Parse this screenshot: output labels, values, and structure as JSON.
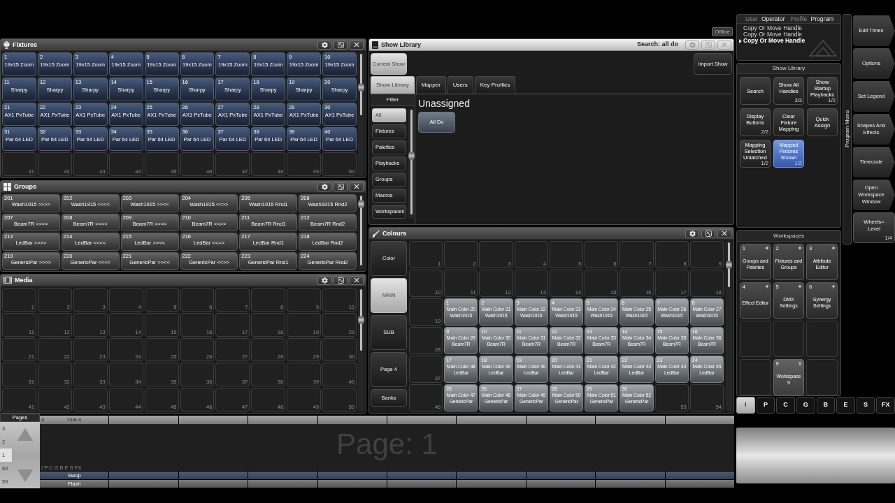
{
  "top_bar": {
    "status": "Offline"
  },
  "fixtures": {
    "title": "Fixtures",
    "active": false,
    "cells": [
      {
        "kind": "fixture",
        "number": "1",
        "label": "19x15 Zoom"
      },
      {
        "kind": "fixture",
        "number": "2",
        "label": "19x15 Zoom"
      },
      {
        "kind": "fixture",
        "number": "3",
        "label": "19x15 Zoom"
      },
      {
        "kind": "fixture",
        "number": "4",
        "label": "19x15 Zoom"
      },
      {
        "kind": "fixture",
        "number": "5",
        "label": "19x15 Zoom"
      },
      {
        "kind": "fixture",
        "number": "6",
        "label": "19x15 Zoom"
      },
      {
        "kind": "fixture",
        "number": "7",
        "label": "19x15 Zoom"
      },
      {
        "kind": "fixture",
        "number": "8",
        "label": "19x15 Zoom"
      },
      {
        "kind": "fixture",
        "number": "9",
        "label": "19x15 Zoom"
      },
      {
        "kind": "fixture",
        "number": "10",
        "label": "19x15 Zoom"
      },
      {
        "kind": "fixture",
        "number": "11",
        "label": "Sharpy"
      },
      {
        "kind": "fixture",
        "number": "12",
        "label": "Sharpy"
      },
      {
        "kind": "fixture",
        "number": "13",
        "label": "Sharpy"
      },
      {
        "kind": "fixture",
        "number": "14",
        "label": "Sharpy"
      },
      {
        "kind": "fixture",
        "number": "15",
        "label": "Sharpy"
      },
      {
        "kind": "fixture",
        "number": "16",
        "label": "Sharpy"
      },
      {
        "kind": "fixture",
        "number": "17",
        "label": "Sharpy"
      },
      {
        "kind": "fixture",
        "number": "18",
        "label": "Sharpy"
      },
      {
        "kind": "fixture",
        "number": "19",
        "label": "Sharpy"
      },
      {
        "kind": "fixture",
        "number": "20",
        "label": "Sharpy"
      },
      {
        "kind": "fixture",
        "number": "21",
        "label": "AX1 PxTube"
      },
      {
        "kind": "fixture",
        "number": "22",
        "label": "AX1 PxTube"
      },
      {
        "kind": "fixture",
        "number": "23",
        "label": "AX1 PxTube"
      },
      {
        "kind": "fixture",
        "number": "24",
        "label": "AX1 PxTube"
      },
      {
        "kind": "fixture",
        "number": "25",
        "label": "AX1 PxTube"
      },
      {
        "kind": "fixture",
        "number": "26",
        "label": "AX1 PxTube"
      },
      {
        "kind": "fixture",
        "number": "27",
        "label": "AX1 PxTube"
      },
      {
        "kind": "fixture",
        "number": "28",
        "label": "AX1 PxTube"
      },
      {
        "kind": "fixture",
        "number": "29",
        "label": "AX1 PxTube"
      },
      {
        "kind": "fixture",
        "number": "30",
        "label": "AX1 PxTube"
      },
      {
        "kind": "fixture",
        "number": "31",
        "label": "Par 64 LED"
      },
      {
        "kind": "fixture",
        "number": "32",
        "label": "Par 64 LED"
      },
      {
        "kind": "fixture",
        "number": "33",
        "label": "Par 64 LED"
      },
      {
        "kind": "fixture",
        "number": "34",
        "label": "Par 64 LED"
      },
      {
        "kind": "fixture",
        "number": "35",
        "label": "Par 64 LED"
      },
      {
        "kind": "fixture",
        "number": "36",
        "label": "Par 64 LED"
      },
      {
        "kind": "fixture",
        "number": "37",
        "label": "Par 64 LED"
      },
      {
        "kind": "fixture",
        "number": "38",
        "label": "Par 64 LED"
      },
      {
        "kind": "fixture",
        "number": "39",
        "label": "Par 64 LED"
      },
      {
        "kind": "fixture",
        "number": "40",
        "label": "Par 64 LED"
      },
      {
        "kind": "empty",
        "number": "41"
      },
      {
        "kind": "empty",
        "number": "42"
      },
      {
        "kind": "empty",
        "number": "43"
      },
      {
        "kind": "empty",
        "number": "44"
      },
      {
        "kind": "empty",
        "number": "45"
      },
      {
        "kind": "empty",
        "number": "46"
      },
      {
        "kind": "empty",
        "number": "47"
      },
      {
        "kind": "empty",
        "number": "48"
      },
      {
        "kind": "empty",
        "number": "49"
      },
      {
        "kind": "empty",
        "number": "50"
      }
    ]
  },
  "groups": {
    "title": "Groups",
    "active": false,
    "cells": [
      {
        "kind": "group",
        "number": "201",
        "label": "Wash1915 >>>>"
      },
      {
        "kind": "group",
        "number": "202",
        "label": "Wash1915 <<<<"
      },
      {
        "kind": "group",
        "number": "203",
        "label": "Wash1915 >><<"
      },
      {
        "kind": "group",
        "number": "204",
        "label": "Wash1915 <<>>"
      },
      {
        "kind": "group",
        "number": "205",
        "label": "Wash1915 Rnd1"
      },
      {
        "kind": "group",
        "number": "206",
        "label": "Wash1915 Rnd2"
      },
      {
        "kind": "group",
        "number": "207",
        "label": "Beam7R >>>>"
      },
      {
        "kind": "group",
        "number": "208",
        "label": "Beam7R <<<<"
      },
      {
        "kind": "group",
        "number": "209",
        "label": "Beam7R >><<"
      },
      {
        "kind": "group",
        "number": "210",
        "label": "Beam7R <<>>"
      },
      {
        "kind": "group",
        "number": "211",
        "label": "Beam7R Rnd1"
      },
      {
        "kind": "group",
        "number": "212",
        "label": "Beam7R Rnd2"
      },
      {
        "kind": "group",
        "number": "213",
        "label": "LedBar >>>>"
      },
      {
        "kind": "group",
        "number": "214",
        "label": "LedBar <<<<"
      },
      {
        "kind": "group",
        "number": "215",
        "label": "LedBar >><<"
      },
      {
        "kind": "group",
        "number": "216",
        "label": "LedBar <<>>"
      },
      {
        "kind": "group",
        "number": "217",
        "label": "LedBar Rnd1"
      },
      {
        "kind": "group",
        "number": "218",
        "label": "LedBar Rnd2"
      },
      {
        "kind": "group",
        "number": "219",
        "label": "GenericPar >>>>"
      },
      {
        "kind": "group",
        "number": "220",
        "label": "GenericPar <<<<"
      },
      {
        "kind": "group",
        "number": "221",
        "label": "GenericPar >><<"
      },
      {
        "kind": "group",
        "number": "222",
        "label": "GenericPar <<>>"
      },
      {
        "kind": "group",
        "number": "223",
        "label": "GenericPar Rnd1"
      },
      {
        "kind": "group",
        "number": "224",
        "label": "GenericPar Rnd2"
      }
    ]
  },
  "media": {
    "title": "Media",
    "active": false,
    "cells": [
      {
        "kind": "empty",
        "number": "1"
      },
      {
        "kind": "empty",
        "number": "2"
      },
      {
        "kind": "empty",
        "number": "3"
      },
      {
        "kind": "empty",
        "number": "4"
      },
      {
        "kind": "empty",
        "number": "5"
      },
      {
        "kind": "empty",
        "number": "6"
      },
      {
        "kind": "empty",
        "number": "7"
      },
      {
        "kind": "empty",
        "number": "8"
      },
      {
        "kind": "empty",
        "number": "9"
      },
      {
        "kind": "empty",
        "number": "10"
      },
      {
        "kind": "empty",
        "number": "11"
      },
      {
        "kind": "empty",
        "number": "12"
      },
      {
        "kind": "empty",
        "number": "13"
      },
      {
        "kind": "empty",
        "number": "14"
      },
      {
        "kind": "empty",
        "number": "15"
      },
      {
        "kind": "empty",
        "number": "16"
      },
      {
        "kind": "empty",
        "number": "17"
      },
      {
        "kind": "empty",
        "number": "18"
      },
      {
        "kind": "empty",
        "number": "19"
      },
      {
        "kind": "empty",
        "number": "20"
      },
      {
        "kind": "empty",
        "number": "21"
      },
      {
        "kind": "empty",
        "number": "22"
      },
      {
        "kind": "empty",
        "number": "23"
      },
      {
        "kind": "empty",
        "number": "24"
      },
      {
        "kind": "empty",
        "number": "25"
      },
      {
        "kind": "empty",
        "number": "26"
      },
      {
        "kind": "empty",
        "number": "27"
      },
      {
        "kind": "empty",
        "number": "28"
      },
      {
        "kind": "empty",
        "number": "29"
      },
      {
        "kind": "empty",
        "number": "30"
      },
      {
        "kind": "empty",
        "number": "31"
      },
      {
        "kind": "empty",
        "number": "32"
      },
      {
        "kind": "empty",
        "number": "33"
      },
      {
        "kind": "empty",
        "number": "34"
      },
      {
        "kind": "empty",
        "number": "35"
      },
      {
        "kind": "empty",
        "number": "36"
      },
      {
        "kind": "empty",
        "number": "37"
      },
      {
        "kind": "empty",
        "number": "38"
      },
      {
        "kind": "empty",
        "number": "39"
      },
      {
        "kind": "empty",
        "number": "40"
      },
      {
        "kind": "empty",
        "number": "41"
      },
      {
        "kind": "empty",
        "number": "42"
      },
      {
        "kind": "empty",
        "number": "43"
      },
      {
        "kind": "empty",
        "number": "44"
      },
      {
        "kind": "empty",
        "number": "45"
      },
      {
        "kind": "empty",
        "number": "46"
      },
      {
        "kind": "empty",
        "number": "47"
      },
      {
        "kind": "empty",
        "number": "48"
      },
      {
        "kind": "empty",
        "number": "49"
      },
      {
        "kind": "empty",
        "number": "50"
      }
    ]
  },
  "show_library": {
    "title": "Show Library",
    "active": true,
    "search": "Search: all do",
    "current_show": {
      "label": "Current Show",
      "selected": true
    },
    "import_button": "Import Show",
    "tabs": [
      {
        "label": "Show Library",
        "selected": true
      },
      {
        "label": "Mapper",
        "selected": false
      },
      {
        "label": "Users",
        "selected": false
      },
      {
        "label": "Key Profiles",
        "selected": false
      }
    ],
    "filter": {
      "title": "Filter",
      "items": [
        {
          "label": "All",
          "selected": true
        },
        {
          "label": "Fixtures",
          "selected": false
        },
        {
          "label": "Palettes",
          "selected": false
        },
        {
          "label": "Playbacks",
          "selected": false
        },
        {
          "label": "Groups",
          "selected": false
        },
        {
          "label": "Macros",
          "selected": false
        },
        {
          "label": "Workspaces",
          "selected": false
        }
      ]
    },
    "section_title": "Unassigned",
    "items": [
      "All Do"
    ]
  },
  "colours": {
    "title": "Colours",
    "active": false,
    "banks": [
      {
        "kind": "page",
        "label": "Color",
        "selected": false
      },
      {
        "kind": "page",
        "label": "MAIN",
        "selected": true
      },
      {
        "kind": "page",
        "label": "SUB",
        "selected": false
      },
      {
        "kind": "page",
        "label": "Page 4",
        "selected": false
      },
      {
        "kind": "menu",
        "label": "Banks",
        "selected": false
      }
    ],
    "cells": [
      {
        "kind": "empty",
        "number": "1"
      },
      {
        "kind": "empty",
        "number": "2"
      },
      {
        "kind": "empty",
        "number": "3"
      },
      {
        "kind": "empty",
        "number": "4"
      },
      {
        "kind": "empty",
        "number": "5"
      },
      {
        "kind": "empty",
        "number": "6"
      },
      {
        "kind": "empty",
        "number": "7"
      },
      {
        "kind": "empty",
        "number": "8"
      },
      {
        "kind": "empty",
        "number": "9"
      },
      {
        "kind": "empty",
        "number": "10"
      },
      {
        "kind": "empty",
        "number": "11"
      },
      {
        "kind": "empty",
        "number": "12"
      },
      {
        "kind": "empty",
        "number": "13"
      },
      {
        "kind": "empty",
        "number": "14"
      },
      {
        "kind": "empty",
        "number": "15"
      },
      {
        "kind": "empty",
        "number": "16"
      },
      {
        "kind": "empty",
        "number": "17"
      },
      {
        "kind": "empty",
        "number": "18"
      },
      {
        "kind": "empty",
        "number": "19"
      },
      {
        "kind": "palette",
        "number": "1",
        "lines": [
          "Main Color 20",
          "Wash1915"
        ]
      },
      {
        "kind": "palette",
        "number": "2",
        "lines": [
          "Main Color 21",
          "Wash1915"
        ]
      },
      {
        "kind": "palette",
        "number": "3",
        "lines": [
          "Main Color 22",
          "Wash1915"
        ]
      },
      {
        "kind": "palette",
        "number": "4",
        "lines": [
          "Main Color 23",
          "Wash1915"
        ]
      },
      {
        "kind": "palette",
        "number": "5",
        "lines": [
          "Main Color 24",
          "Wash1915"
        ]
      },
      {
        "kind": "palette",
        "number": "6",
        "lines": [
          "Main Color 25",
          "Wash1915"
        ]
      },
      {
        "kind": "palette",
        "number": "7",
        "lines": [
          "Main Color 26",
          "Wash1915"
        ]
      },
      {
        "kind": "palette",
        "number": "8",
        "lines": [
          "Main Color 27",
          "Wash1915"
        ]
      },
      {
        "kind": "empty",
        "number": "28"
      },
      {
        "kind": "palette",
        "number": "9",
        "lines": [
          "Main Color 29",
          "Beam7R"
        ]
      },
      {
        "kind": "palette",
        "number": "10",
        "lines": [
          "Main Color 30",
          "Beam7R"
        ]
      },
      {
        "kind": "palette",
        "number": "11",
        "lines": [
          "Main Color 31",
          "Beam7R"
        ]
      },
      {
        "kind": "palette",
        "number": "12",
        "lines": [
          "Main Color 32",
          "Beam7R"
        ]
      },
      {
        "kind": "palette",
        "number": "13",
        "lines": [
          "Main Color 33",
          "Beam7R"
        ]
      },
      {
        "kind": "palette",
        "number": "14",
        "lines": [
          "Main Color 34",
          "Beam7R"
        ]
      },
      {
        "kind": "palette",
        "number": "15",
        "lines": [
          "Main Color 35",
          "Beam7R"
        ]
      },
      {
        "kind": "palette",
        "number": "16",
        "lines": [
          "Main Color 36",
          "Beam7R"
        ]
      },
      {
        "kind": "empty",
        "number": "37"
      },
      {
        "kind": "palette",
        "number": "17",
        "lines": [
          "Main Color 38",
          "LedBar"
        ]
      },
      {
        "kind": "palette",
        "number": "18",
        "lines": [
          "Main Color 39",
          "LedBar"
        ]
      },
      {
        "kind": "palette",
        "number": "19",
        "lines": [
          "Main Color 40",
          "LedBar"
        ]
      },
      {
        "kind": "palette",
        "number": "20",
        "lines": [
          "Main Color 41",
          "LedBar"
        ]
      },
      {
        "kind": "palette",
        "number": "21",
        "lines": [
          "Main Color 42",
          "LedBar"
        ]
      },
      {
        "kind": "palette",
        "number": "22",
        "lines": [
          "Main Color 43",
          "LedBar"
        ]
      },
      {
        "kind": "palette",
        "number": "23",
        "lines": [
          "Main Color 44",
          "LedBar"
        ]
      },
      {
        "kind": "palette",
        "number": "24",
        "lines": [
          "Main Color 45",
          "LedBar"
        ]
      },
      {
        "kind": "empty",
        "number": "46"
      },
      {
        "kind": "palette",
        "number": "25",
        "lines": [
          "Main Color 47",
          "GenericPar"
        ]
      },
      {
        "kind": "palette",
        "number": "26",
        "lines": [
          "Main Color 48",
          "GenericPar"
        ]
      },
      {
        "kind": "palette",
        "number": "27",
        "lines": [
          "Main Color 49",
          "GenericPar"
        ]
      },
      {
        "kind": "palette",
        "number": "28",
        "lines": [
          "Main Color 50",
          "GenericPar"
        ]
      },
      {
        "kind": "palette",
        "number": "29",
        "lines": [
          "Main Color 51",
          "GenericPar"
        ]
      },
      {
        "kind": "palette",
        "number": "30",
        "lines": [
          "Main Color 52",
          "GenericPar"
        ]
      },
      {
        "kind": "empty",
        "number": "53"
      },
      {
        "kind": "empty",
        "number": "54"
      }
    ]
  },
  "user_panel": {
    "user_label": "User",
    "user": "Operator",
    "profile_label": "Profile",
    "profile": "Program",
    "history": [
      {
        "text": "Copy Or Move Handle",
        "current": false
      },
      {
        "text": "Copy Or Move Handle",
        "current": false
      },
      {
        "text": "Copy Or Move Handle",
        "current": true
      }
    ]
  },
  "library_menu": {
    "title": "Show Library",
    "buttons": [
      {
        "lines": [
          "Search"
        ],
        "active": false
      },
      {
        "lines": [
          "Show All",
          "Handles"
        ],
        "counter": "3/3",
        "active": false
      },
      {
        "lines": [
          "Show",
          "Startup",
          "Playbacks"
        ],
        "counter": "1/2",
        "active": false
      },
      {
        "lines": [
          "Display",
          "Buttons"
        ],
        "counter": "2/2",
        "active": false
      },
      {
        "lines": [
          "Clear",
          "Fixture",
          "Mapping"
        ],
        "active": false
      },
      {
        "lines": [
          "Quick",
          "Assign"
        ],
        "active": false
      },
      {
        "lines": [
          "Mapping",
          "Selection",
          "Unlatched"
        ],
        "counter": "1/2",
        "active": false
      },
      {
        "lines": [
          "Mapped",
          "Fixtures",
          "Shown"
        ],
        "counter": "1/2",
        "active": true
      }
    ]
  },
  "workspaces": {
    "title": "Workspaces",
    "slots": [
      {
        "kind": "preset",
        "number": "1",
        "lines": [
          "Groups and",
          "Palettes"
        ]
      },
      {
        "kind": "preset",
        "number": "2",
        "lines": [
          "Fixtures and",
          "Groups"
        ]
      },
      {
        "kind": "preset",
        "number": "3",
        "lines": [
          "Attribute",
          "Editor"
        ]
      },
      {
        "kind": "preset",
        "number": "4",
        "lines": [
          "Effect Editor"
        ]
      },
      {
        "kind": "preset",
        "number": "5",
        "lines": [
          "DMX",
          "Settings"
        ]
      },
      {
        "kind": "preset",
        "number": "6",
        "lines": [
          "Synergy",
          "Settings"
        ]
      },
      {
        "kind": "empty"
      },
      {
        "kind": "empty"
      },
      {
        "kind": "empty"
      },
      {
        "kind": "empty"
      },
      {
        "kind": "custom",
        "number": "9",
        "corner": "X",
        "lines": [
          "Workspace",
          "9"
        ]
      },
      {
        "kind": "empty"
      }
    ]
  },
  "program_menu": {
    "title": "Program Menu",
    "buttons": [
      {
        "kind": "submenu",
        "lines": [
          "Edit Times"
        ]
      },
      {
        "kind": "submenu",
        "lines": [
          "Options"
        ]
      },
      {
        "kind": "submenu",
        "lines": [
          "Set Legend"
        ]
      },
      {
        "kind": "submenu",
        "lines": [
          "Shapes And",
          "Effects"
        ]
      },
      {
        "kind": "submenu",
        "lines": [
          "Timecode"
        ]
      },
      {
        "kind": "submenu",
        "lines": [
          "Open",
          "Workspace",
          "Window"
        ]
      },
      {
        "kind": "toggle",
        "lines": [
          "Wheels=",
          "Level"
        ],
        "counter": "1/4"
      }
    ]
  },
  "mode_buttons": [
    {
      "label": "I",
      "selected": true
    },
    {
      "label": "P",
      "selected": false
    },
    {
      "label": "C",
      "selected": false
    },
    {
      "label": "G",
      "selected": false
    },
    {
      "label": "B",
      "selected": false
    },
    {
      "label": "E",
      "selected": false
    },
    {
      "label": "S",
      "selected": false
    },
    {
      "label": "FX",
      "selected": false
    }
  ],
  "playback_bar": {
    "pages_title": "Pages",
    "pages": [
      {
        "label": "3",
        "selected": false
      },
      {
        "label": "2",
        "selected": false
      },
      {
        "label": "1",
        "selected": true
      },
      {
        "label": "60",
        "selected": false
      },
      {
        "label": "59",
        "selected": false
      }
    ],
    "page_title": "Page: 1",
    "mode_keys": "I P C G B E S FX",
    "playbacks": [
      {
        "kind": "assigned",
        "number": "4",
        "legend": "Cue 4",
        "swop": "Swop",
        "flash": "Flash"
      },
      {
        "kind": "empty"
      },
      {
        "kind": "empty"
      },
      {
        "kind": "empty"
      },
      {
        "kind": "empty"
      },
      {
        "kind": "empty"
      },
      {
        "kind": "empty"
      },
      {
        "kind": "empty"
      },
      {
        "kind": "empty"
      },
      {
        "kind": "empty"
      }
    ]
  }
}
